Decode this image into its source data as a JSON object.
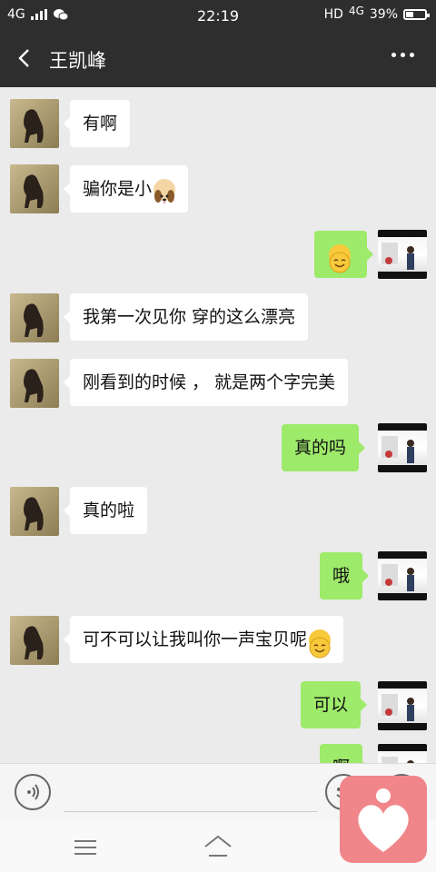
{
  "status": {
    "network": "4G",
    "time": "22:19",
    "hd": "HD",
    "net_right": "4G",
    "battery": "39%",
    "battery_level": 0.39
  },
  "header": {
    "title": "王凯峰"
  },
  "messages": [
    {
      "side": "in",
      "text": "有啊",
      "emoji": ""
    },
    {
      "side": "in",
      "text": "骗你是小",
      "emoji": "dog-face-emoji"
    },
    {
      "side": "out",
      "text": "",
      "emoji": "smile-emoji"
    },
    {
      "side": "in",
      "text": "我第一次见你 穿的这么漂亮",
      "emoji": ""
    },
    {
      "side": "in",
      "text": "刚看到的时候 ， 就是两个字完美",
      "emoji": ""
    },
    {
      "side": "out",
      "text": "真的吗",
      "emoji": ""
    },
    {
      "side": "in",
      "text": "真的啦",
      "emoji": ""
    },
    {
      "side": "out",
      "text": "哦",
      "emoji": ""
    },
    {
      "side": "in",
      "text": "可不可以让我叫你一声宝贝呢",
      "emoji": "smile-emoji"
    },
    {
      "side": "out",
      "text": "可以",
      "emoji": ""
    },
    {
      "side": "out",
      "text": "啊",
      "emoji": ""
    }
  ],
  "input": {
    "placeholder": ""
  },
  "colors": {
    "bubble_out": "#9eea6a",
    "bubble_in": "#ffffff",
    "header": "#2e2e2e",
    "overlay_app": "#f0868a"
  }
}
